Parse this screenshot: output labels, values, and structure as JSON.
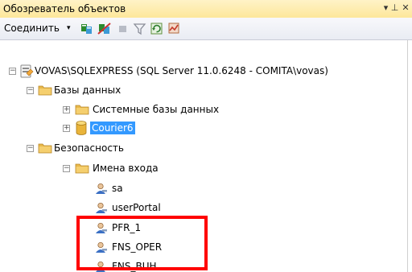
{
  "panel": {
    "title": "Обозреватель объектов",
    "pin_glyph": "▾ ⊥",
    "close_glyph": "✕"
  },
  "toolbar": {
    "connect_label": "Соединить",
    "connect_dropdown_glyph": "▾"
  },
  "tree": {
    "server": "VOVAS\\SQLEXPRESS (SQL Server 11.0.6248 - COMITA\\vovas)",
    "databases": "Базы данных",
    "system_databases": "Системные базы данных",
    "courier_db": "Courier6",
    "security": "Безопасность",
    "logins": "Имена входа",
    "login_items": [
      "sa",
      "userPortal",
      "PFR_1",
      "FNS_OPER",
      "FNS_BUH"
    ]
  },
  "colors": {
    "title_bg": "#fde79a",
    "selection": "#3399ff",
    "highlight_box": "#ff0000",
    "folder": "#e8b84a"
  },
  "icons": {
    "server": "server-icon",
    "folder": "folder-icon",
    "database": "database-icon",
    "login": "user-login-icon"
  }
}
